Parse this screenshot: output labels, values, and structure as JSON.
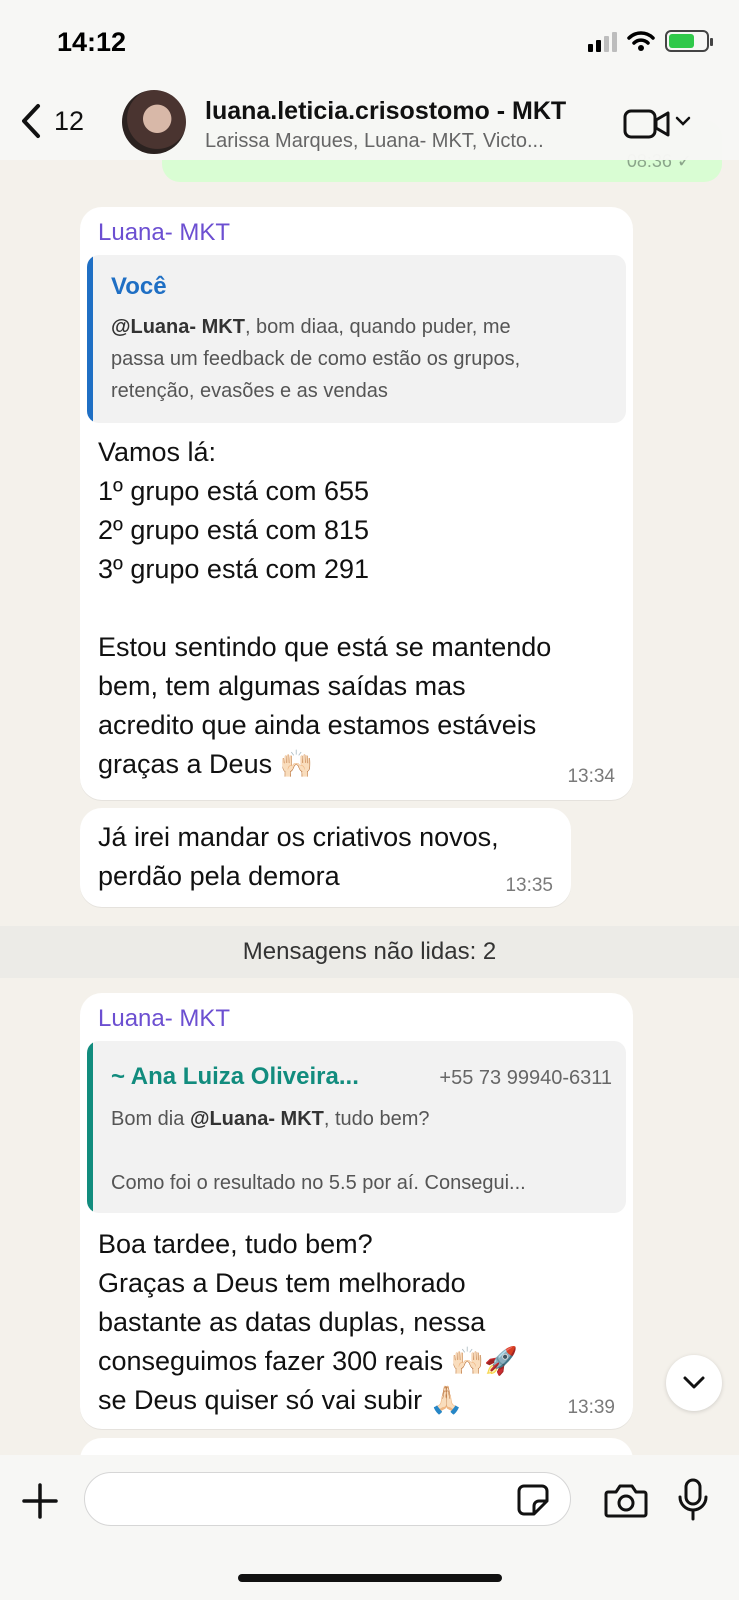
{
  "status_bar": {
    "time": "14:12",
    "battery_charging": true
  },
  "header": {
    "back_count": "12",
    "title": "luana.leticia.crisostomo - MKT",
    "subtitle": "Larissa Marques, Luana- MKT, Victo..."
  },
  "messages": [
    {
      "sender": "Luana- MKT",
      "quote": {
        "author": "Você",
        "author_color": "#1f6fc4",
        "mention": "@Luana- MKT",
        "text_line1": ", bom diaa, quando puder, me",
        "text_line2": "passa um feedback de como estão os grupos,",
        "text_line3": "retenção, evasões e as vendas"
      },
      "text": "Vamos lá:\n1º grupo está com 655\n2º grupo está com 815\n3º grupo está com 291\n\nEstou sentindo que está se mantendo\nbem, tem algumas saídas mas\nacredito que ainda estamos estáveis\ngraças a Deus 🙌🏻",
      "time": "13:34"
    },
    {
      "text": "Já irei mandar os criativos novos,\nperdão pela demora",
      "time": "13:35"
    },
    {
      "sender": "Luana- MKT",
      "quote": {
        "author": "~ Ana Luiza Oliveira...",
        "author_color": "#128c7e",
        "phone": "+55 73 99940-6311",
        "prefix": "Bom dia ",
        "mention": "@Luana- MKT",
        "suffix": ", tudo bem?",
        "line2": "Como foi o resultado no 5.5 por aí. Consegui..."
      },
      "text": "Boa tardee, tudo bem?\nGraças a Deus tem melhorado\nbastante as datas duplas, nessa\nconseguimos fazer 300 reais 🙌🏻🚀\nse Deus quiser só vai subir 🙏🏻",
      "time": "13:39"
    }
  ],
  "unread_divider": "Mensagens não lidas: 2",
  "composer": {
    "placeholder": "",
    "value": ""
  },
  "colors": {
    "outgoing_bubble": "#d9fdd3",
    "sender_name": "#6c4fd1",
    "chat_bg": "#f4f1eb"
  }
}
